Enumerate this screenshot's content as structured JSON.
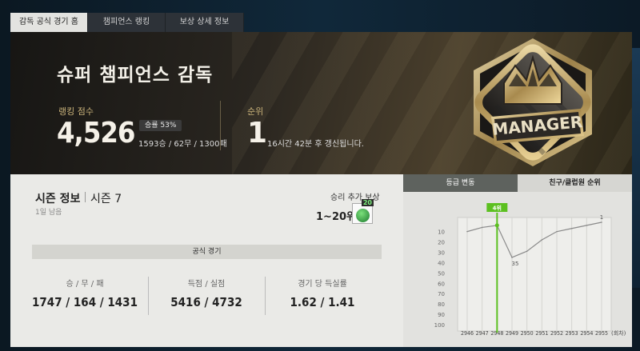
{
  "tabs": [
    {
      "label": "감독 공식 경기 홈",
      "active": true
    },
    {
      "label": "챔피언스 랭킹",
      "active": false
    },
    {
      "label": "보상 상세 정보",
      "active": false
    }
  ],
  "hero": {
    "title": "슈퍼 챔피언스 감독",
    "rank_label": "랭킹 점수",
    "rank_value": "4,526",
    "winrate_badge": "승률 53%",
    "record": "1593승 / 62무 / 1300패",
    "position_label": "순위",
    "position_value": "1",
    "refresh_text": "16시간 42분 후 갱신됩니다.",
    "emblem_text": "MANAGER"
  },
  "season": {
    "title": "시즌 정보",
    "season_num": "시즌 7",
    "days_left": "1일 남음",
    "bonus_label": "승리 추가 보상",
    "bonus_range": "1~20위",
    "bonus_badge": "20",
    "official_label": "공식 경기",
    "stats": [
      {
        "label": "승 / 무 / 패",
        "value": "1747 / 164 / 1431"
      },
      {
        "label": "득점 / 실점",
        "value": "5416 / 4732"
      },
      {
        "label": "경기 당 득실률",
        "value": "1.62 / 1.41"
      }
    ]
  },
  "chart_tabs": [
    "등급 변동",
    "친구/클럽원 순위"
  ],
  "colors": {
    "accent_green": "#5cc020",
    "gold": "#c9b27a"
  },
  "chart_data": {
    "type": "line",
    "x": [
      "2946",
      "2947",
      "2948",
      "2949",
      "2950",
      "2951",
      "2952",
      "2953",
      "2954",
      "2955"
    ],
    "x_suffix": "(회차)",
    "y_ticks": [
      10,
      20,
      30,
      40,
      50,
      60,
      70,
      80,
      90,
      100
    ],
    "y_reversed": true,
    "ylim": [
      1,
      100
    ],
    "values": [
      10,
      6,
      4,
      35,
      29,
      18,
      10,
      7,
      4,
      1
    ],
    "highlight": {
      "x": "2948",
      "label": "4위"
    },
    "point_labels": [
      {
        "x": "2949",
        "label": "35"
      },
      {
        "x": "2955",
        "label": "1"
      }
    ]
  }
}
